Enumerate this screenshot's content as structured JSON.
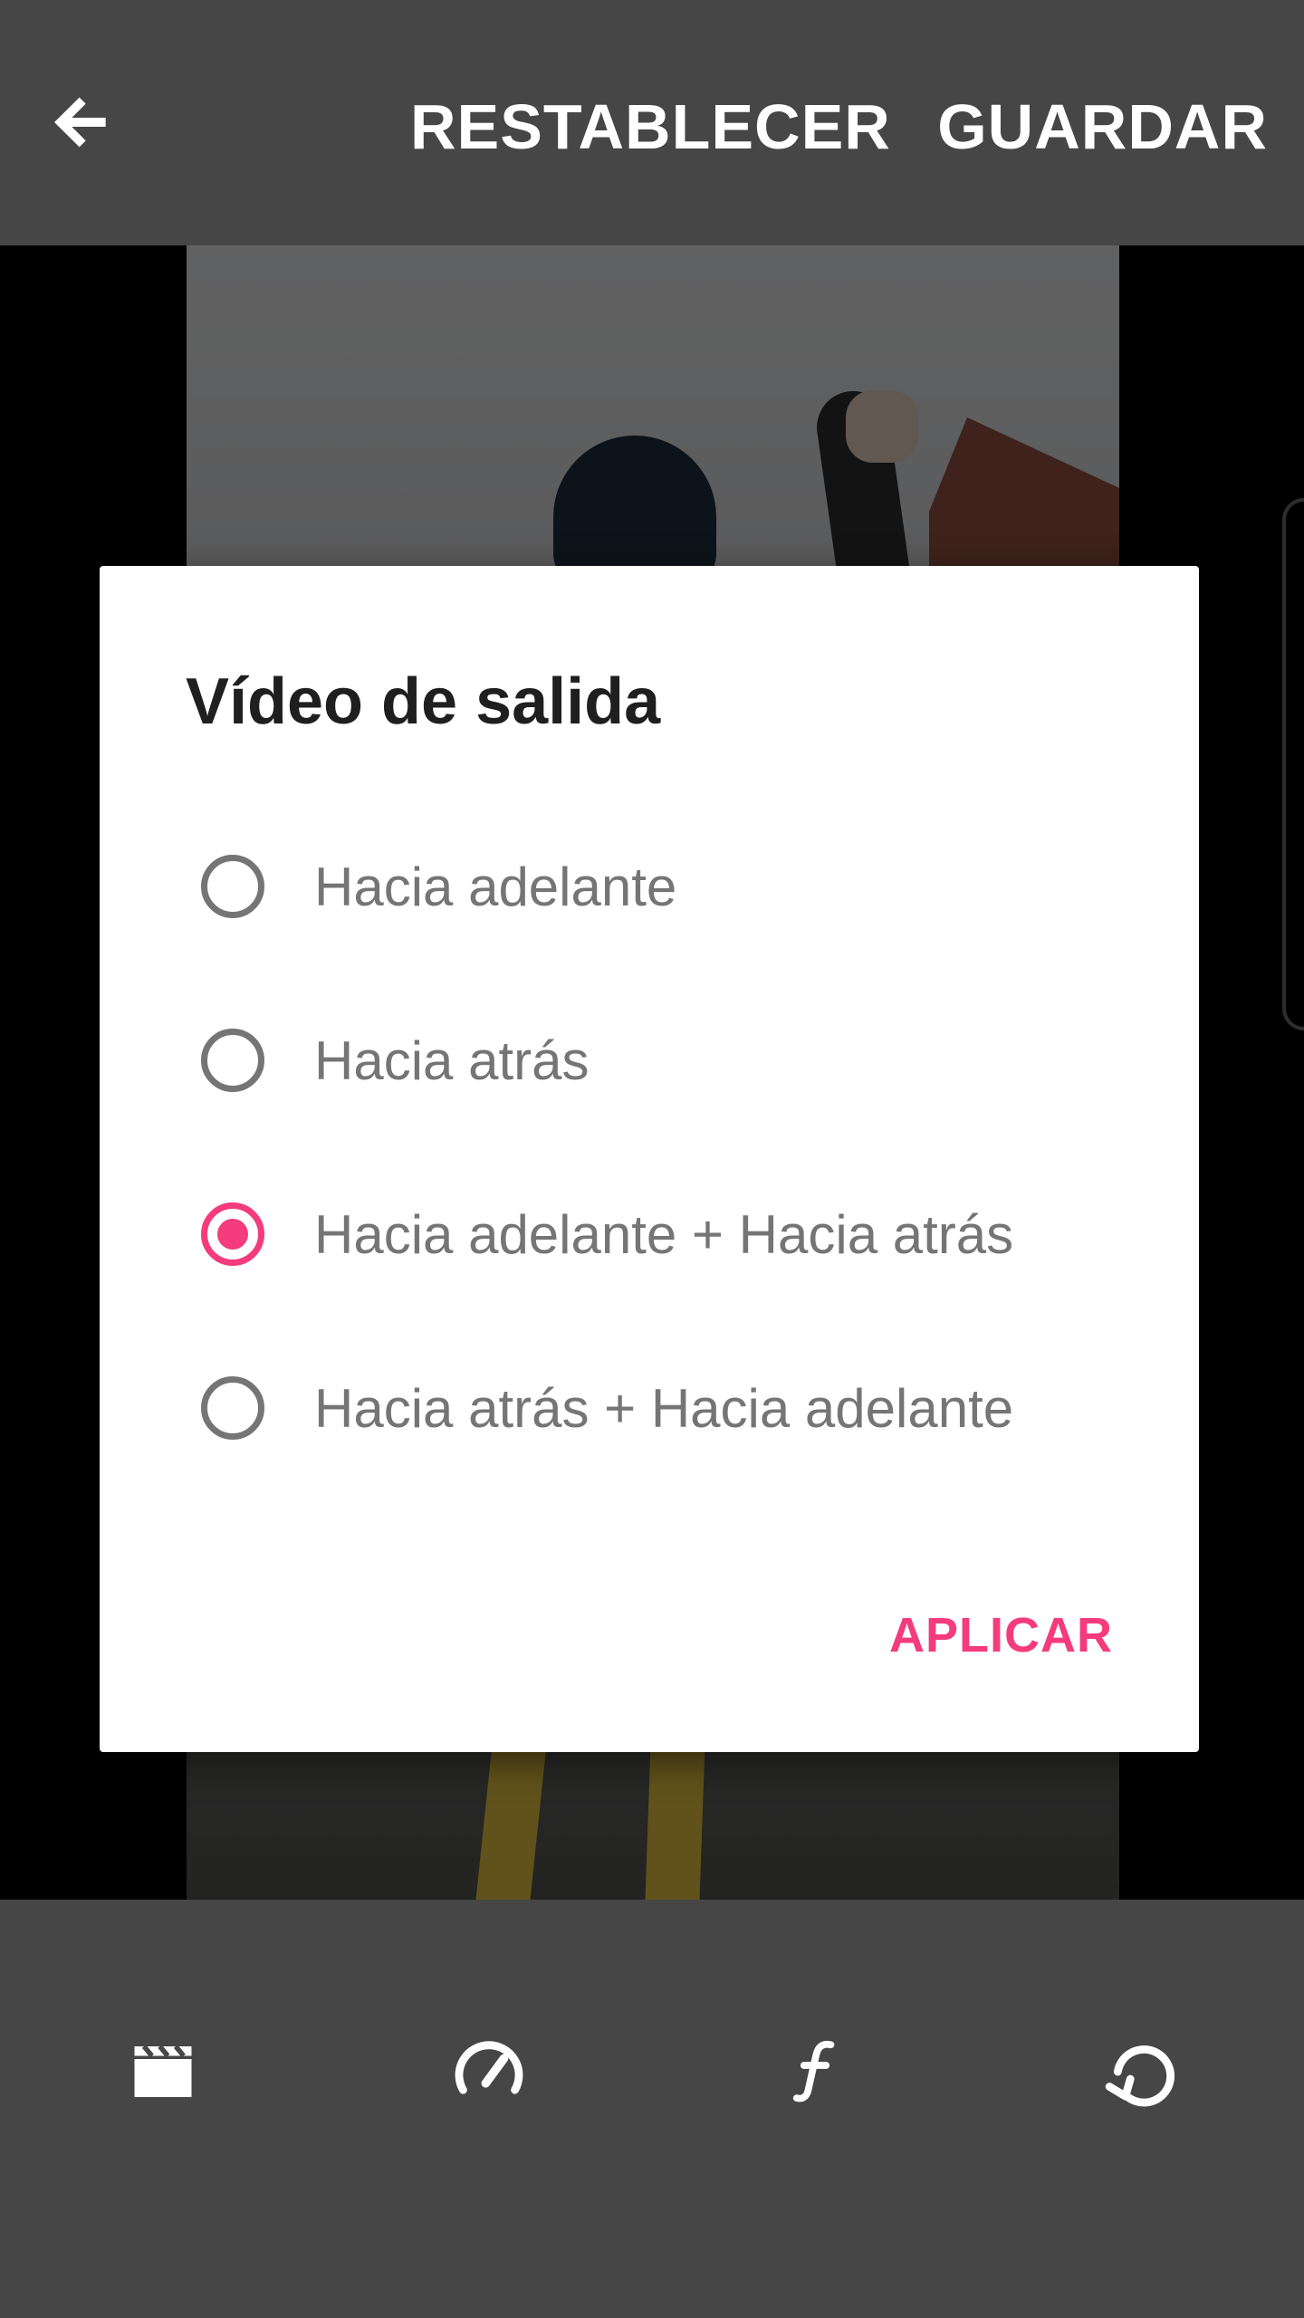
{
  "toolbar": {
    "back_icon": "arrow-left-icon",
    "reset_label": "RESTABLECER",
    "save_label": "GUARDAR"
  },
  "dialog": {
    "title": "Vídeo de salida",
    "options": [
      {
        "label": "Hacia adelante",
        "selected": false
      },
      {
        "label": "Hacia atrás",
        "selected": false
      },
      {
        "label": "Hacia adelante + Hacia atrás",
        "selected": true
      },
      {
        "label": "Hacia atrás + Hacia adelante",
        "selected": false
      }
    ],
    "apply_label": "APLICAR"
  },
  "bottom_tools": [
    {
      "icon": "clapperboard-icon"
    },
    {
      "icon": "speedometer-icon"
    },
    {
      "icon": "function-icon"
    },
    {
      "icon": "loop-icon"
    }
  ],
  "colors": {
    "bar_background": "#464646",
    "accent": "#f43b7c",
    "radio_unchecked": "#757575"
  }
}
